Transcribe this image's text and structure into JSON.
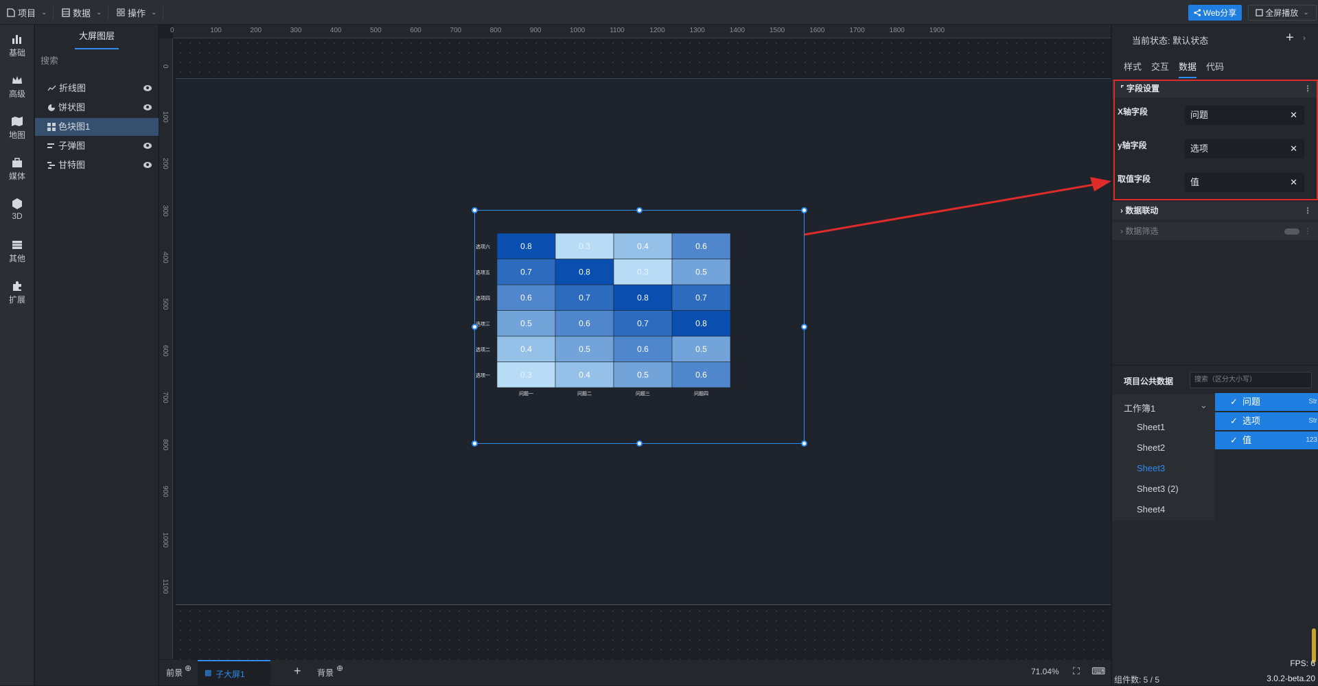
{
  "topbar": {
    "menus": [
      {
        "label": "项目"
      },
      {
        "label": "数据"
      },
      {
        "label": "操作"
      }
    ],
    "web_share": "Web分享",
    "fullscreen": "全屏播放"
  },
  "left_nav": [
    {
      "label": "基础"
    },
    {
      "label": "高级"
    },
    {
      "label": "地图"
    },
    {
      "label": "媒体"
    },
    {
      "label": "3D"
    },
    {
      "label": "其他"
    },
    {
      "label": "扩展"
    }
  ],
  "layers": {
    "title": "大屏图层",
    "search_placeholder": "搜索",
    "items": [
      {
        "label": "折线图"
      },
      {
        "label": "饼状图"
      },
      {
        "label": "色块图1"
      },
      {
        "label": "子弹图"
      },
      {
        "label": "甘特图"
      }
    ]
  },
  "ruler": {
    "top": [
      "0",
      "100",
      "200",
      "300",
      "400",
      "500",
      "600",
      "700",
      "800",
      "900",
      "1000",
      "1100",
      "1200",
      "1300",
      "1400",
      "1500",
      "1600",
      "1700",
      "1800",
      "1900"
    ],
    "left": [
      "0",
      "100",
      "200",
      "300",
      "400",
      "500",
      "600",
      "700",
      "800",
      "900",
      "1000",
      "1100"
    ]
  },
  "bottom": {
    "tab_front": "前景",
    "tab_sub": "子大屏1",
    "tab_bg": "背景",
    "zoom": "71.04%"
  },
  "right_panel": {
    "state_label": "当前状态:  默认状态",
    "tabs": [
      "样式",
      "交互",
      "数据",
      "代码"
    ],
    "field_section": "字段设置",
    "fields": [
      {
        "label": "X轴字段",
        "value": "问题"
      },
      {
        "label": "y轴字段",
        "value": "选项"
      },
      {
        "label": "取值字段",
        "value": "值"
      }
    ],
    "data_link": "数据联动",
    "data_filter": "数据筛选",
    "public_data": "项目公共数据",
    "public_search_placeholder": "搜索（区分大小写）",
    "workbook": "工作簿1",
    "sheets": [
      "Sheet1",
      "Sheet2",
      "Sheet3",
      "Sheet3 (2)",
      "Sheet4"
    ],
    "data_fields": [
      {
        "name": "问题",
        "type": "Str"
      },
      {
        "name": "选项",
        "type": "Str"
      },
      {
        "name": "值",
        "type": "123"
      }
    ],
    "fps": "FPS: 6",
    "component_count": "组件数: 5 / 5",
    "version": "3.0.2-beta.20"
  },
  "colors": {
    "accent": "#2f8cf0",
    "highlight_box": "#e02b2b",
    "arrow": "#e02b2b"
  },
  "chart_data": {
    "type": "heatmap",
    "x_categories": [
      "问题一",
      "问题二",
      "问题三",
      "问题四"
    ],
    "y_categories": [
      "选项一",
      "选项二",
      "选项三",
      "选项四",
      "选项五",
      "选项六"
    ],
    "values": [
      [
        0.3,
        0.4,
        0.5,
        0.6
      ],
      [
        0.4,
        0.5,
        0.6,
        0.5
      ],
      [
        0.5,
        0.6,
        0.7,
        0.8
      ],
      [
        0.6,
        0.7,
        0.8,
        0.7
      ],
      [
        0.7,
        0.8,
        0.3,
        0.5
      ],
      [
        0.8,
        0.3,
        0.4,
        0.6
      ]
    ],
    "color_range": [
      "#b8dcf5",
      "#0a4fb0"
    ]
  }
}
